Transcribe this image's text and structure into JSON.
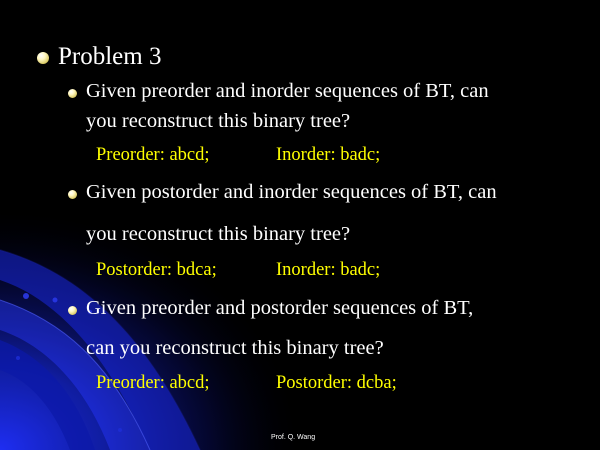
{
  "slide": {
    "title": "Problem 3",
    "items": [
      {
        "line1": "Given preorder and inorder sequences of BT,  can",
        "line2": "you reconstruct this binary tree?",
        "seq_a": "Preorder: abcd;",
        "seq_b": "Inorder: badc;"
      },
      {
        "line1": "Given postorder and inorder sequences of BT,  can",
        "line2": "you reconstruct this binary tree?",
        "seq_a": "Postorder: bdca;",
        "seq_b": "Inorder: badc;"
      },
      {
        "line1": "Given preorder and postorder sequences of BT,",
        "line2": "can you reconstruct this binary tree?",
        "seq_a": "Preorder: abcd;",
        "seq_b": "Postorder: dcba;"
      }
    ],
    "footer": "Prof. Q. Wang"
  },
  "colors": {
    "background": "#000000",
    "text": "#ffffff",
    "sequence_text": "#ffff00",
    "decor_blue": "#1020c0"
  }
}
